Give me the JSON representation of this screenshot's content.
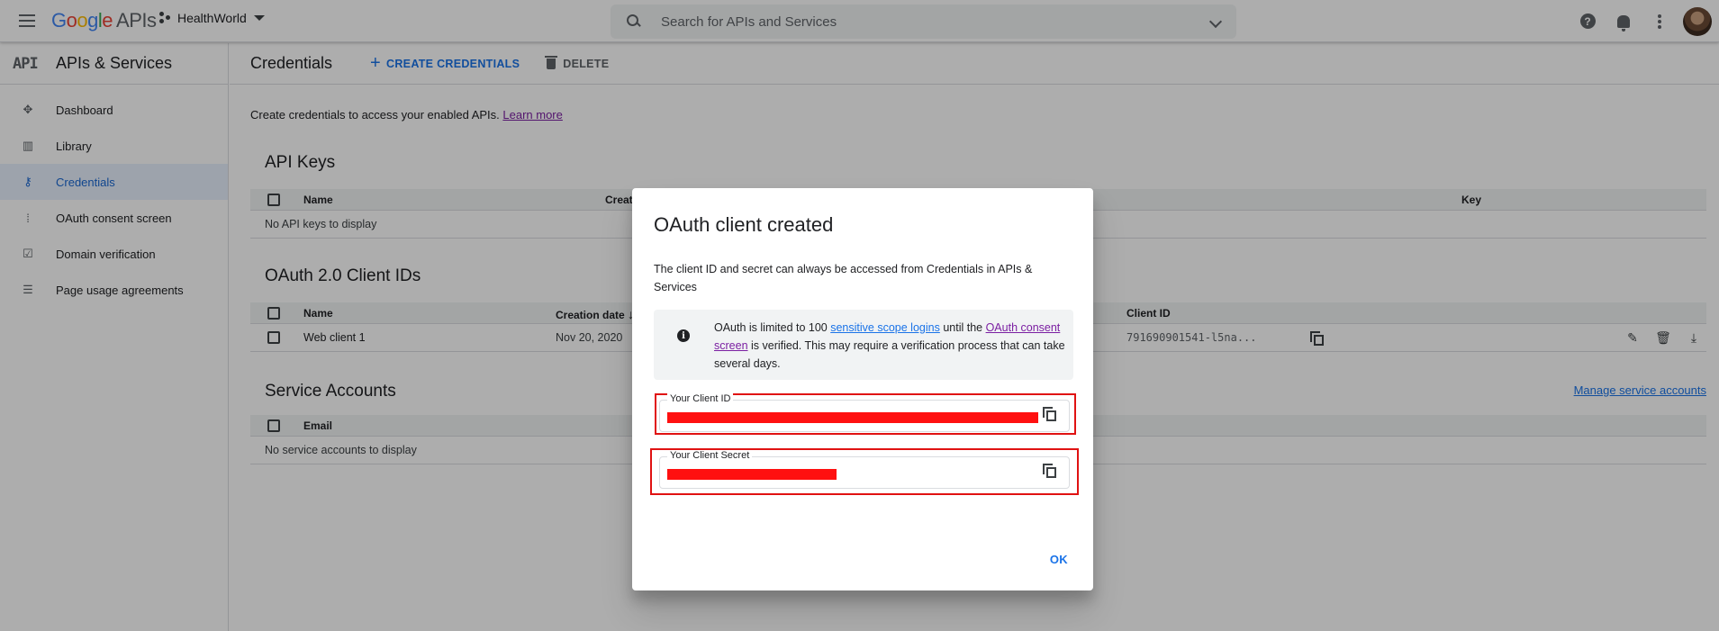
{
  "topbar": {
    "logo_google": [
      "G",
      "o",
      "o",
      "g",
      "l",
      "e"
    ],
    "logo_apis": "APIs",
    "project": "HealthWorld",
    "search_placeholder": "Search for APIs and Services",
    "help_glyph": "?"
  },
  "sidebar": {
    "mark": "API",
    "title": "APIs & Services",
    "items": [
      {
        "label": "Dashboard",
        "icon": "dashboard-icon",
        "glyph": "✥"
      },
      {
        "label": "Library",
        "icon": "library-icon",
        "glyph": "▥"
      },
      {
        "label": "Credentials",
        "icon": "key-icon",
        "glyph": "⚷",
        "active": true
      },
      {
        "label": "OAuth consent screen",
        "icon": "consent-icon",
        "glyph": "⁞"
      },
      {
        "label": "Domain verification",
        "icon": "checkbox-icon",
        "glyph": "☑"
      },
      {
        "label": "Page usage agreements",
        "icon": "settings-list-icon",
        "glyph": "☰"
      }
    ]
  },
  "main": {
    "title": "Credentials",
    "create_label": "CREATE CREDENTIALS",
    "create_glyph": "+",
    "delete_label": "DELETE",
    "intro": "Create credentials to access your enabled APIs.",
    "learn_more": "Learn more",
    "api_keys": {
      "title": "API Keys",
      "headers": {
        "name": "Name",
        "creation": "Creat",
        "key": "Key"
      },
      "empty": "No API keys to display"
    },
    "oauth": {
      "title": "OAuth 2.0 Client IDs",
      "headers": {
        "name": "Name",
        "creation": "Creation date",
        "sort_glyph": "↓",
        "client_id": "Client ID"
      },
      "rows": [
        {
          "name": "Web client 1",
          "date": "Nov 20, 2020",
          "client_id": "791690901541-l5na..."
        }
      ],
      "row_glyphs": {
        "edit": "✎",
        "delete": "🗑",
        "download": "⤓"
      }
    },
    "service": {
      "title": "Service Accounts",
      "manage_link": "Manage service accounts",
      "headers": {
        "email": "Email"
      },
      "empty": "No service accounts to display"
    }
  },
  "dialog": {
    "title": "OAuth client created",
    "text": "The client ID and secret can always be accessed from Credentials in APIs & Services",
    "info": {
      "glyph": "i",
      "p1": "OAuth is limited to 100 ",
      "link1": "sensitive scope logins",
      "p2": " until the ",
      "link2": "OAuth consent screen",
      "p3": " is verified. This may require a verification process that can take several days."
    },
    "client_id_label": "Your Client ID",
    "client_secret_label": "Your Client Secret",
    "ok_label": "OK",
    "highlight_color": "#e01212"
  }
}
